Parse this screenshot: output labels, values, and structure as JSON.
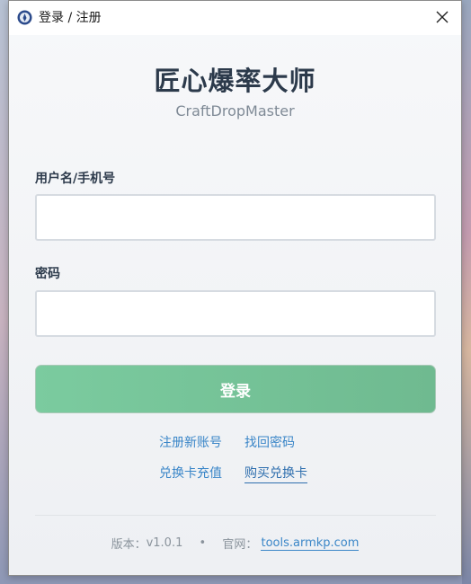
{
  "window": {
    "title": "登录 / 注册",
    "icon": "app-logo-icon",
    "close_icon": "close-icon"
  },
  "header": {
    "title": "匠心爆率大师",
    "subtitle": "CraftDropMaster"
  },
  "form": {
    "username_label": "用户名/手机号",
    "username_value": "",
    "password_label": "密码",
    "password_value": "",
    "login_button": "登录"
  },
  "links": {
    "register": "注册新账号",
    "recover_password": "找回密码",
    "redeem_card": "兑换卡充值",
    "buy_card": "购买兑换卡"
  },
  "footer": {
    "version_label": "版本：",
    "version": "v1.0.1",
    "separator": "•",
    "site_label": "官网：",
    "site": "tools.armkp.com"
  },
  "colors": {
    "accent": "#3a86c8",
    "button_green": "#76c59a",
    "title_dark": "#2c3a4b"
  }
}
